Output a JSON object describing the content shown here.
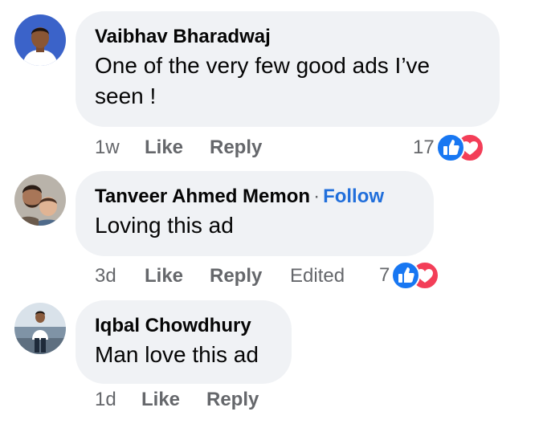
{
  "comments": [
    {
      "author": "Vaibhav Bharadwaj",
      "text_line1": "One of the very few good ads I’ve",
      "text_line2": "seen !",
      "time": "1w",
      "like": "Like",
      "reply": "Reply",
      "reaction_count": "17"
    },
    {
      "author": "Tanveer Ahmed Memon",
      "separator": "·",
      "follow": "Follow",
      "text": "Loving this ad",
      "time": "3d",
      "like": "Like",
      "reply": "Reply",
      "edited": "Edited",
      "reaction_count": "7"
    },
    {
      "author": "Iqbal Chowdhury",
      "text": "Man love this ad",
      "time": "1d",
      "like": "Like",
      "reply": "Reply"
    }
  ],
  "colors": {
    "bubble": "#f0f2f5",
    "meta_text": "#65676b",
    "follow_link": "#216fdb",
    "like_reaction": "#1877f2",
    "love_reaction": "#f33e58"
  },
  "icons": {
    "like_reaction": "thumbs-up-icon",
    "love_reaction": "heart-icon"
  }
}
